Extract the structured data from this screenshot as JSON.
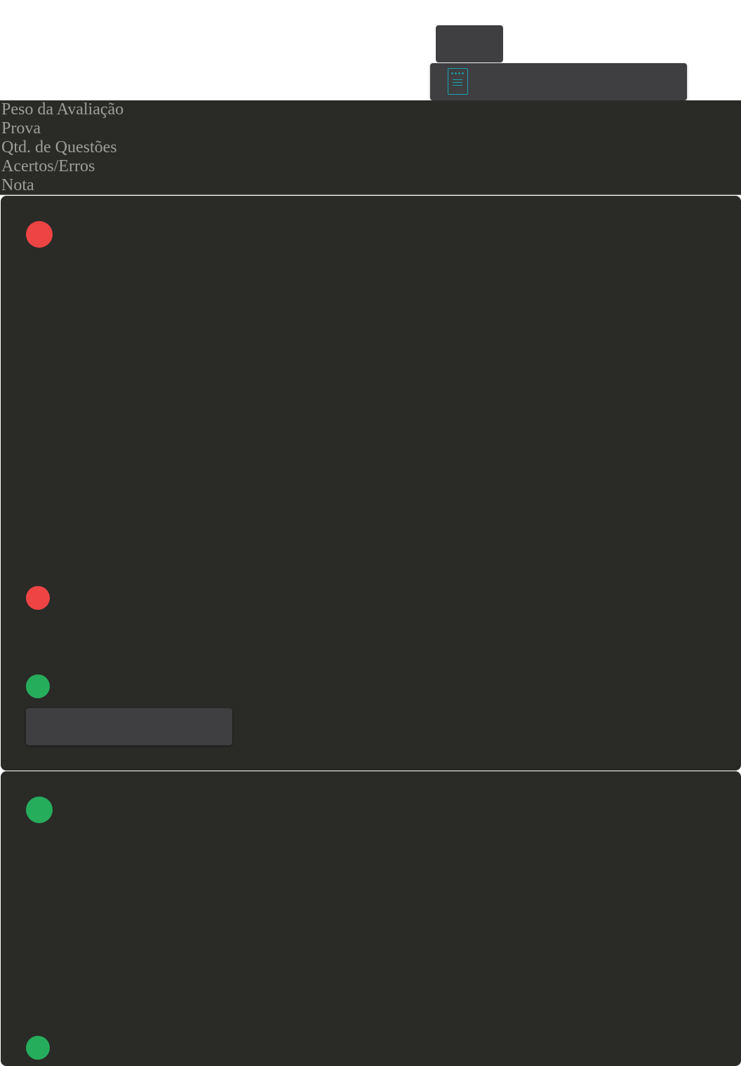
{
  "header": {
    "rows": [
      "Peso da Avaliação",
      "Prova",
      "Qtd. de Questões",
      "Acertos/Erros",
      "Nota"
    ]
  },
  "toolbar": {
    "doc_icon": "document-icon"
  },
  "status_colors": {
    "wrong": "#ee4444",
    "correct": "#26ad5c"
  }
}
